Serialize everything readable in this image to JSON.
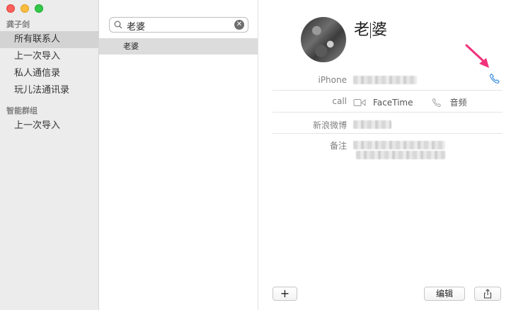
{
  "sidebar": {
    "group1": "龚子剑",
    "items1": [
      {
        "label": "所有联系人",
        "selected": true
      },
      {
        "label": "上一次导入",
        "selected": false
      },
      {
        "label": "私人通信录",
        "selected": false
      },
      {
        "label": "玩儿法通讯录",
        "selected": false
      }
    ],
    "group2": "智能群组",
    "items2": [
      {
        "label": "上一次导入",
        "selected": false
      }
    ]
  },
  "search": {
    "value": "老婆",
    "clear_icon": "clear-icon"
  },
  "list": {
    "contact": "老婆"
  },
  "detail": {
    "name": "老婆",
    "fields": {
      "iphone_label": "iPhone",
      "call_label": "call",
      "facetime_label": "FaceTime",
      "audio_label": "音频",
      "weibo_label": "新浪微博",
      "note_label": "备注"
    }
  },
  "footer": {
    "add_label": "+",
    "edit_label": "编辑"
  },
  "colors": {
    "accent_blue": "#2c86dc",
    "arrow_pink": "#f0327a",
    "sidebar_bg": "#ececec",
    "selected_bg": "#d3d3d3"
  }
}
